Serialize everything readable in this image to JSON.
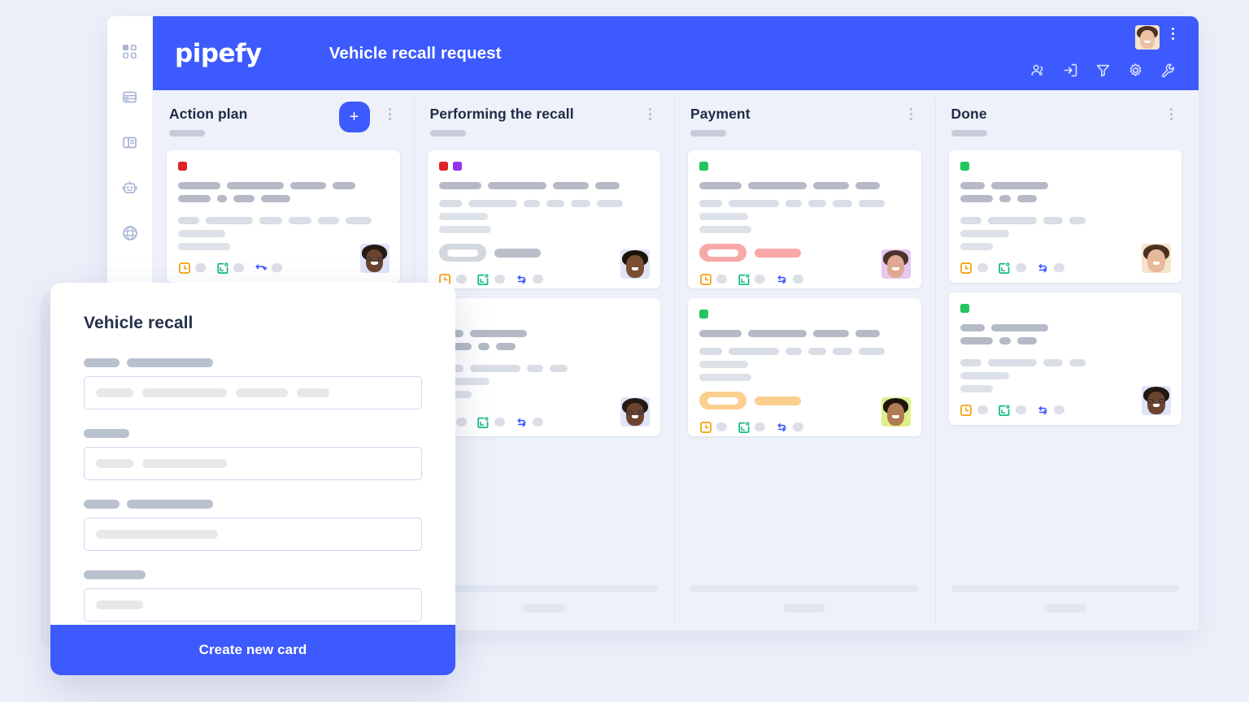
{
  "app": {
    "logo_text": "pipefy",
    "header_title": "Vehicle recall request",
    "accent_color": "#3d5afe",
    "page_background": "#edf0fa",
    "board_background": "#eef1f9"
  },
  "sidebar": {
    "items": [
      {
        "icon": "grid-dashboard-icon",
        "label": "Dashboard"
      },
      {
        "icon": "database-icon",
        "label": "Database"
      },
      {
        "icon": "board-layout-icon",
        "label": "Board layout"
      },
      {
        "icon": "robot-automation-icon",
        "label": "Automations"
      },
      {
        "icon": "globe-icon",
        "label": "Public"
      }
    ]
  },
  "header": {
    "avatar_label": "User avatar",
    "kebab_label": "More options",
    "tools": [
      {
        "icon": "members-icon",
        "label": "Members"
      },
      {
        "icon": "import-inbox-icon",
        "label": "Inbox"
      },
      {
        "icon": "filter-icon",
        "label": "Filter"
      },
      {
        "icon": "gear-icon",
        "label": "Settings"
      },
      {
        "icon": "wrench-icon",
        "label": "Tools"
      }
    ]
  },
  "board": {
    "add_card_label": "+",
    "columns": [
      {
        "title": "Action plan",
        "has_add_button": true,
        "cards": [
          {
            "labels": [
              "#e02424"
            ],
            "badge": null,
            "avatar": {
              "skin": "#6b4430",
              "hair": "#241a14",
              "bg": "#dfe4f7",
              "glasses": true,
              "smile": true
            },
            "icons": [
              "clock-icon",
              "calendar-check-icon",
              "flow-connection-icon"
            ]
          }
        ]
      },
      {
        "title": "Performing the recall",
        "has_add_button": false,
        "cards": [
          {
            "labels": [
              "#e02424",
              "#9333ea"
            ],
            "badge": {
              "color": "#d3d7de",
              "type": "neutral"
            },
            "avatar": {
              "skin": "#7a4f33",
              "hair": "#1b1208",
              "bg": "#dfe4f7",
              "glasses": false,
              "smile": true
            },
            "icons": [
              "clock-icon",
              "calendar-check-icon",
              "flow-connection-icon"
            ]
          },
          {
            "labels": [],
            "badge": null,
            "avatar": {
              "skin": "#6b4430",
              "hair": "#241a14",
              "bg": "#dfe4f7",
              "glasses": true,
              "smile": true
            },
            "icons": [
              "clock-icon",
              "calendar-check-icon",
              "flow-connection-icon"
            ]
          }
        ]
      },
      {
        "title": "Payment",
        "has_add_button": false,
        "cards": [
          {
            "labels": [
              "#22c55e"
            ],
            "badge": {
              "color": "#f9a8a8",
              "type": "overdue"
            },
            "avatar": {
              "skin": "#e0a890",
              "hair": "#4a342a",
              "bg": "#e6c8f2",
              "glasses": false,
              "smile": true
            },
            "icons": [
              "clock-icon",
              "calendar-check-icon",
              "flow-connection-icon"
            ]
          },
          {
            "labels": [
              "#22c55e"
            ],
            "badge": {
              "color": "#fbcf8f",
              "type": "due-soon"
            },
            "avatar": {
              "skin": "#b07a52",
              "hair": "#1d1410",
              "bg": "#ddf08a",
              "glasses": false,
              "smile": true
            },
            "icons": [
              "clock-icon",
              "calendar-check-icon",
              "flow-connection-icon"
            ]
          }
        ]
      },
      {
        "title": "Done",
        "has_add_button": false,
        "cards": [
          {
            "labels": [
              "#22c55e"
            ],
            "badge": null,
            "avatar": {
              "skin": "#e8b89a",
              "hair": "#4a3122",
              "bg": "#f6e3cb",
              "glasses": false,
              "smile": true
            },
            "icons": [
              "clock-icon",
              "calendar-check-icon",
              "flow-connection-icon"
            ]
          },
          {
            "labels": [
              "#22c55e"
            ],
            "badge": null,
            "avatar": {
              "skin": "#6b4430",
              "hair": "#231811",
              "bg": "#dfe4f7",
              "glasses": true,
              "smile": true
            },
            "icons": [
              "clock-icon",
              "calendar-check-icon",
              "flow-connection-icon"
            ]
          }
        ]
      }
    ]
  },
  "modal": {
    "title": "Vehicle recall",
    "submit_label": "Create new card",
    "fields": [
      {
        "label_bars": [
          44,
          106
        ],
        "input_bars": [
          52,
          110,
          70,
          38
        ]
      },
      {
        "label_bars": [
          56
        ],
        "input_bars": [
          52,
          110
        ]
      },
      {
        "label_bars": [
          44,
          106
        ],
        "input_bars": [
          148
        ]
      },
      {
        "label_bars": [
          76
        ],
        "input_bars": [
          58
        ]
      }
    ]
  },
  "icon_colors": {
    "clock": "#f59e0b",
    "calendar": "#10b981",
    "flow": "#3d5afe",
    "label_gray": "#dcdfe6"
  }
}
